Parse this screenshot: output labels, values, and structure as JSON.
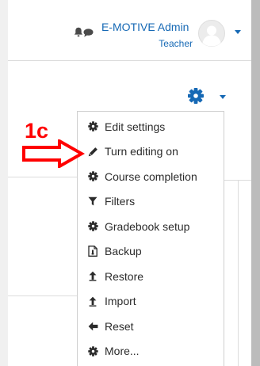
{
  "navbar": {
    "user_name": "E-MOTIVE Admin",
    "user_role": "Teacher",
    "icons": [
      "bell-icon",
      "chat-icon",
      "avatar",
      "chevron-down-icon"
    ]
  },
  "course_actions": {
    "trigger_icon": "gear-icon",
    "items": [
      {
        "label": "Edit settings",
        "icon": "gear-icon"
      },
      {
        "label": "Turn editing on",
        "icon": "pencil-icon"
      },
      {
        "label": "Course completion",
        "icon": "gear-icon"
      },
      {
        "label": "Filters",
        "icon": "filter-icon"
      },
      {
        "label": "Gradebook setup",
        "icon": "gear-icon"
      },
      {
        "label": "Backup",
        "icon": "file-icon"
      },
      {
        "label": "Restore",
        "icon": "upload-icon"
      },
      {
        "label": "Import",
        "icon": "upload-icon"
      },
      {
        "label": "Reset",
        "icon": "arrow-left-icon"
      },
      {
        "label": "More...",
        "icon": "gear-icon"
      }
    ]
  },
  "annotation": {
    "label": "1c",
    "color": "#ff0000"
  },
  "colors": {
    "link": "#1669b5",
    "menu_text": "#2b2b2b",
    "annotation": "#ff0000"
  }
}
